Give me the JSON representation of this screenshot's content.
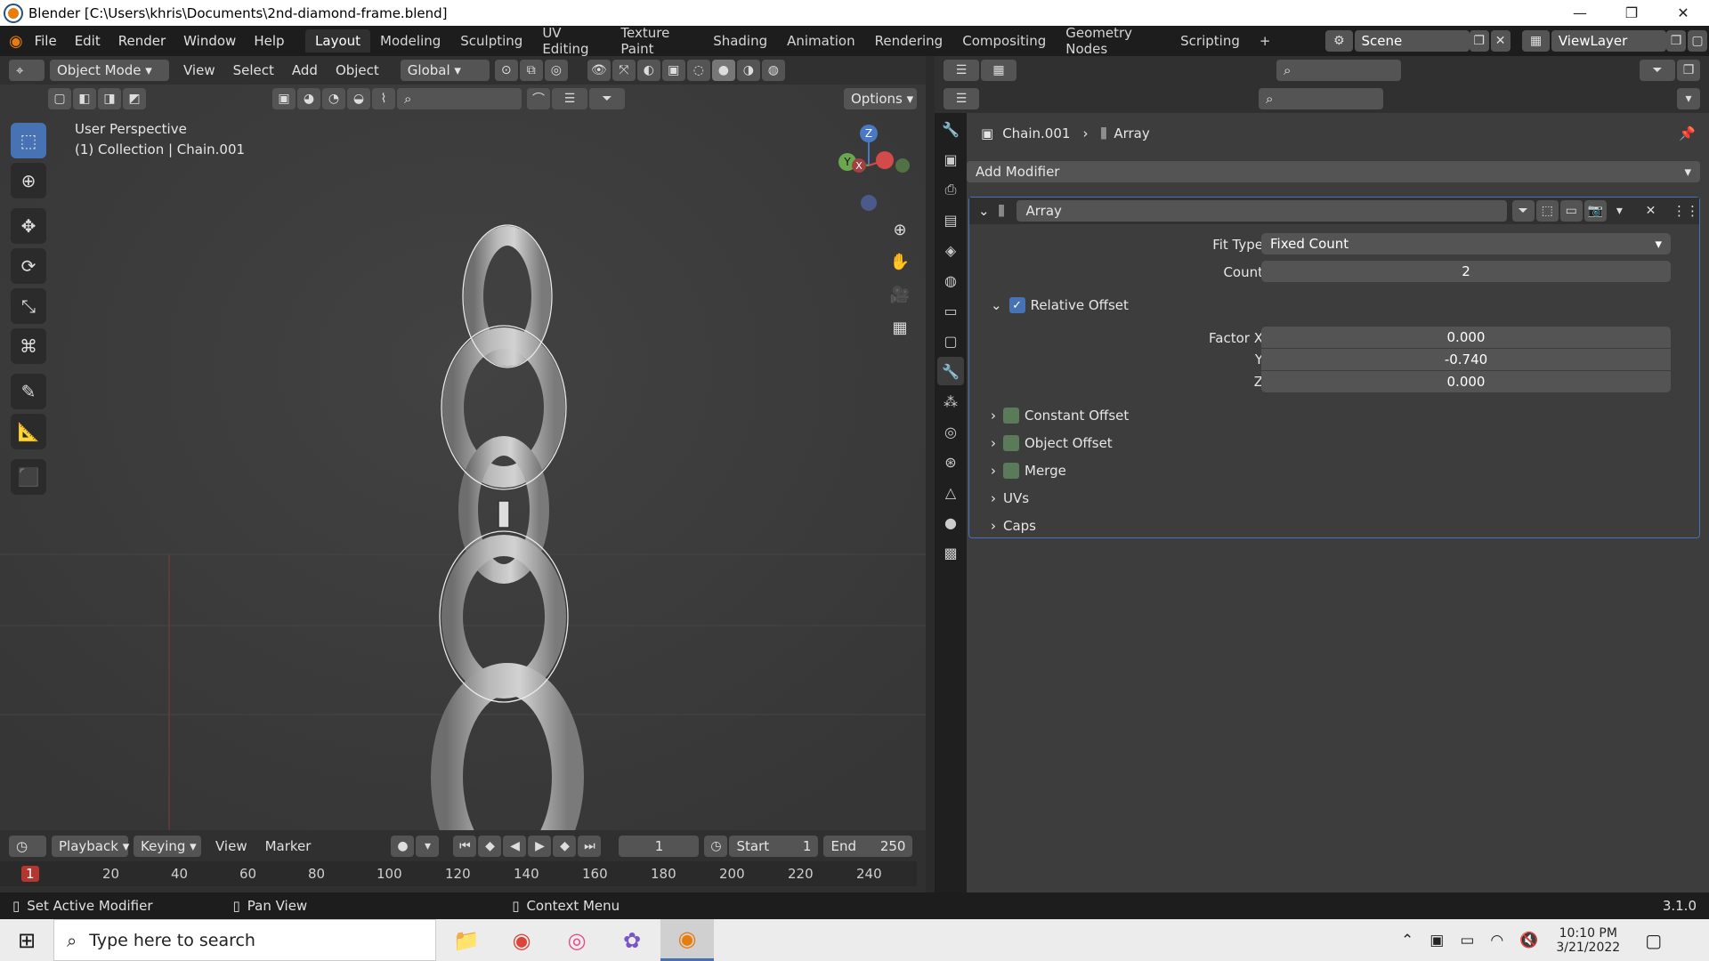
{
  "window": {
    "title": "Blender [C:\\Users\\khris\\Documents\\2nd-diamond-frame.blend]",
    "minimize": "—",
    "restore": "❐",
    "close": "✕"
  },
  "menu": [
    "File",
    "Edit",
    "Render",
    "Window",
    "Help"
  ],
  "workspace_tabs": [
    "Layout",
    "Modeling",
    "Sculpting",
    "UV Editing",
    "Texture Paint",
    "Shading",
    "Animation",
    "Rendering",
    "Compositing",
    "Geometry Nodes",
    "Scripting"
  ],
  "add_workspace": "+",
  "scene": "Scene",
  "view_layer": "ViewLayer",
  "viewport": {
    "mode": "Object Mode",
    "menus": [
      "View",
      "Select",
      "Add",
      "Object"
    ],
    "orientation": "Global",
    "options": "Options",
    "perspective": "User Perspective",
    "collection": "(1) Collection | Chain.001",
    "gizmo": {
      "z": "Z",
      "y": "Y",
      "x": "X"
    }
  },
  "timeline": {
    "menus": [
      "Playback",
      "Keying",
      "View",
      "Marker"
    ],
    "current_frame": "1",
    "start_label": "Start",
    "start": "1",
    "end_label": "End",
    "end": "250",
    "ruler": [
      "1",
      "20",
      "40",
      "60",
      "80",
      "100",
      "120",
      "140",
      "160",
      "180",
      "200",
      "220",
      "240"
    ]
  },
  "status": {
    "left": "Set Active Modifier",
    "middle": "Pan View",
    "right": "Context Menu",
    "version": "3.1.0"
  },
  "properties": {
    "breadcrumb_object": "Chain.001",
    "breadcrumb_modifier": "Array",
    "add_modifier": "Add Modifier",
    "modifier_name": "Array",
    "fit_type_label": "Fit Type",
    "fit_type": "Fixed Count",
    "count_label": "Count",
    "count": "2",
    "relative_offset": "Relative Offset",
    "factor_x_label": "Factor X",
    "factor_x": "0.000",
    "y_label": "Y",
    "y": "-0.740",
    "z_label": "Z",
    "z": "0.000",
    "sections": [
      "Constant Offset",
      "Object Offset",
      "Merge",
      "UVs",
      "Caps"
    ]
  },
  "taskbar": {
    "search_placeholder": "Type here to search",
    "time": "10:10 PM",
    "date": "3/21/2022"
  },
  "colors": {
    "accent": "#4772b3",
    "blender_orange": "#e87d0d"
  }
}
